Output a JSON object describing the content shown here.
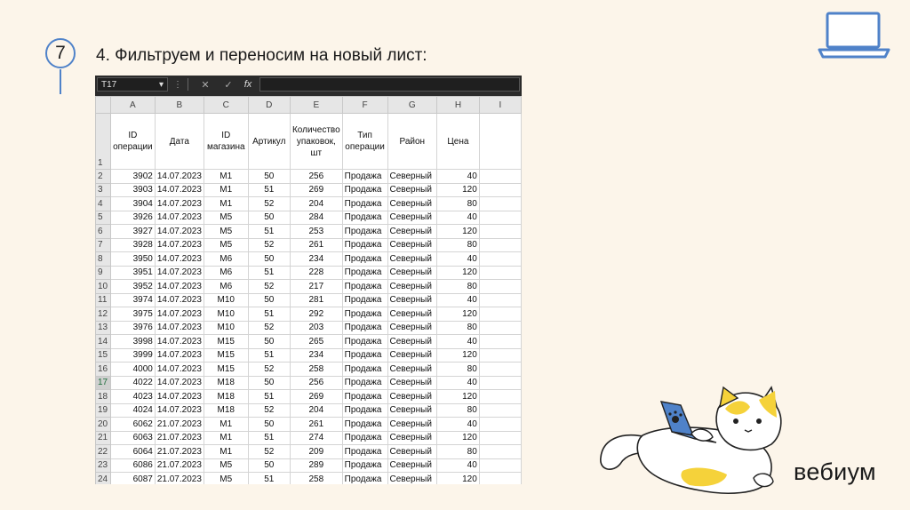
{
  "slide": {
    "step_number": "7",
    "title": "4. Фильтруем и переносим на новый лист:",
    "brand": "вебиум"
  },
  "excel": {
    "name_box": "T17",
    "formula_cancel": "✕",
    "formula_enter": "✓",
    "formula_fx": "fx",
    "columns": [
      "A",
      "B",
      "C",
      "D",
      "E",
      "F",
      "G",
      "H",
      "I"
    ],
    "header_row_number": "1",
    "headers": [
      "ID операции",
      "Дата",
      "ID магазина",
      "Артикул",
      "Количество упаковок, шт",
      "Тип операции",
      "Район",
      "Цена",
      ""
    ],
    "rows": [
      {
        "n": "2",
        "cells": [
          "3902",
          "14.07.2023",
          "M1",
          "50",
          "256",
          "Продажа",
          "Северный",
          "40"
        ]
      },
      {
        "n": "3",
        "cells": [
          "3903",
          "14.07.2023",
          "M1",
          "51",
          "269",
          "Продажа",
          "Северный",
          "120"
        ]
      },
      {
        "n": "4",
        "cells": [
          "3904",
          "14.07.2023",
          "M1",
          "52",
          "204",
          "Продажа",
          "Северный",
          "80"
        ]
      },
      {
        "n": "5",
        "cells": [
          "3926",
          "14.07.2023",
          "M5",
          "50",
          "284",
          "Продажа",
          "Северный",
          "40"
        ]
      },
      {
        "n": "6",
        "cells": [
          "3927",
          "14.07.2023",
          "M5",
          "51",
          "253",
          "Продажа",
          "Северный",
          "120"
        ]
      },
      {
        "n": "7",
        "cells": [
          "3928",
          "14.07.2023",
          "M5",
          "52",
          "261",
          "Продажа",
          "Северный",
          "80"
        ]
      },
      {
        "n": "8",
        "cells": [
          "3950",
          "14.07.2023",
          "M6",
          "50",
          "234",
          "Продажа",
          "Северный",
          "40"
        ]
      },
      {
        "n": "9",
        "cells": [
          "3951",
          "14.07.2023",
          "M6",
          "51",
          "228",
          "Продажа",
          "Северный",
          "120"
        ]
      },
      {
        "n": "10",
        "cells": [
          "3952",
          "14.07.2023",
          "M6",
          "52",
          "217",
          "Продажа",
          "Северный",
          "80"
        ]
      },
      {
        "n": "11",
        "cells": [
          "3974",
          "14.07.2023",
          "M10",
          "50",
          "281",
          "Продажа",
          "Северный",
          "40"
        ]
      },
      {
        "n": "12",
        "cells": [
          "3975",
          "14.07.2023",
          "M10",
          "51",
          "292",
          "Продажа",
          "Северный",
          "120"
        ]
      },
      {
        "n": "13",
        "cells": [
          "3976",
          "14.07.2023",
          "M10",
          "52",
          "203",
          "Продажа",
          "Северный",
          "80"
        ]
      },
      {
        "n": "14",
        "cells": [
          "3998",
          "14.07.2023",
          "M15",
          "50",
          "265",
          "Продажа",
          "Северный",
          "40"
        ]
      },
      {
        "n": "15",
        "cells": [
          "3999",
          "14.07.2023",
          "M15",
          "51",
          "234",
          "Продажа",
          "Северный",
          "120"
        ]
      },
      {
        "n": "16",
        "cells": [
          "4000",
          "14.07.2023",
          "M15",
          "52",
          "258",
          "Продажа",
          "Северный",
          "80"
        ]
      },
      {
        "n": "17",
        "cells": [
          "4022",
          "14.07.2023",
          "M18",
          "50",
          "256",
          "Продажа",
          "Северный",
          "40"
        ],
        "selected": true
      },
      {
        "n": "18",
        "cells": [
          "4023",
          "14.07.2023",
          "M18",
          "51",
          "269",
          "Продажа",
          "Северный",
          "120"
        ]
      },
      {
        "n": "19",
        "cells": [
          "4024",
          "14.07.2023",
          "M18",
          "52",
          "204",
          "Продажа",
          "Северный",
          "80"
        ]
      },
      {
        "n": "20",
        "cells": [
          "6062",
          "21.07.2023",
          "M1",
          "50",
          "261",
          "Продажа",
          "Северный",
          "40"
        ]
      },
      {
        "n": "21",
        "cells": [
          "6063",
          "21.07.2023",
          "M1",
          "51",
          "274",
          "Продажа",
          "Северный",
          "120"
        ]
      },
      {
        "n": "22",
        "cells": [
          "6064",
          "21.07.2023",
          "M1",
          "52",
          "209",
          "Продажа",
          "Северный",
          "80"
        ]
      },
      {
        "n": "23",
        "cells": [
          "6086",
          "21.07.2023",
          "M5",
          "50",
          "289",
          "Продажа",
          "Северный",
          "40"
        ]
      },
      {
        "n": "24",
        "cells": [
          "6087",
          "21.07.2023",
          "M5",
          "51",
          "258",
          "Продажа",
          "Северный",
          "120"
        ]
      }
    ]
  },
  "icons": {
    "step_badge": "step-circle",
    "laptop": "laptop-icon",
    "cat": "cat-with-laptop-illustration",
    "dropdown": "chevron-down-icon"
  },
  "colors": {
    "background": "#fcf5ea",
    "accent_blue": "#4f82c9",
    "excel_dark": "#2b2b2b",
    "cat_yellow": "#f5d23a"
  }
}
